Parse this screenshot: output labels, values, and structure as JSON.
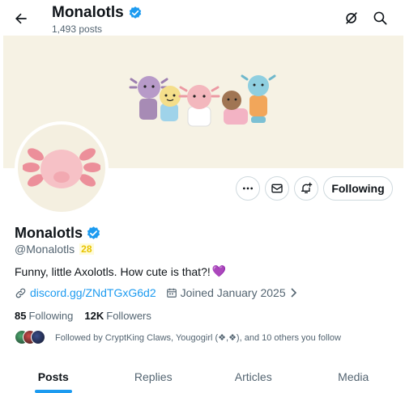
{
  "header": {
    "title": "Monalotls",
    "posts_count": "1,493 posts"
  },
  "profile": {
    "display_name": "Monalotls",
    "handle": "@Monalotls",
    "handle_badge": "28",
    "bio": "Funny, little Axolotls. How cute is that?!",
    "bio_emoji": "💜",
    "link": "discord.gg/ZNdTGxG6d2",
    "joined": "Joined January 2025",
    "following_count": "85",
    "following_label": "Following",
    "followers_count": "12K",
    "followers_label": "Followers",
    "followed_by": "Followed by CryptKing Claws, Yougogirl (❖,❖), and 10 others you follow"
  },
  "actions": {
    "follow_label": "Following"
  },
  "tabs": [
    {
      "label": "Posts",
      "active": true
    },
    {
      "label": "Replies",
      "active": false
    },
    {
      "label": "Articles",
      "active": false
    },
    {
      "label": "Media",
      "active": false
    }
  ],
  "colors": {
    "accent": "#1d9bf0",
    "verified": "#1d9bf0",
    "text_secondary": "#536471",
    "banner_bg": "#f6f2e4",
    "avatar_pink": "#f3b7bd"
  },
  "icons": {
    "back": "arrow-left-icon",
    "grok": "grok-icon",
    "search": "search-icon",
    "more": "more-icon",
    "message": "mail-icon",
    "notify": "bell-plus-icon",
    "link": "link-icon",
    "calendar": "calendar-icon",
    "verified": "verified-badge-icon"
  }
}
